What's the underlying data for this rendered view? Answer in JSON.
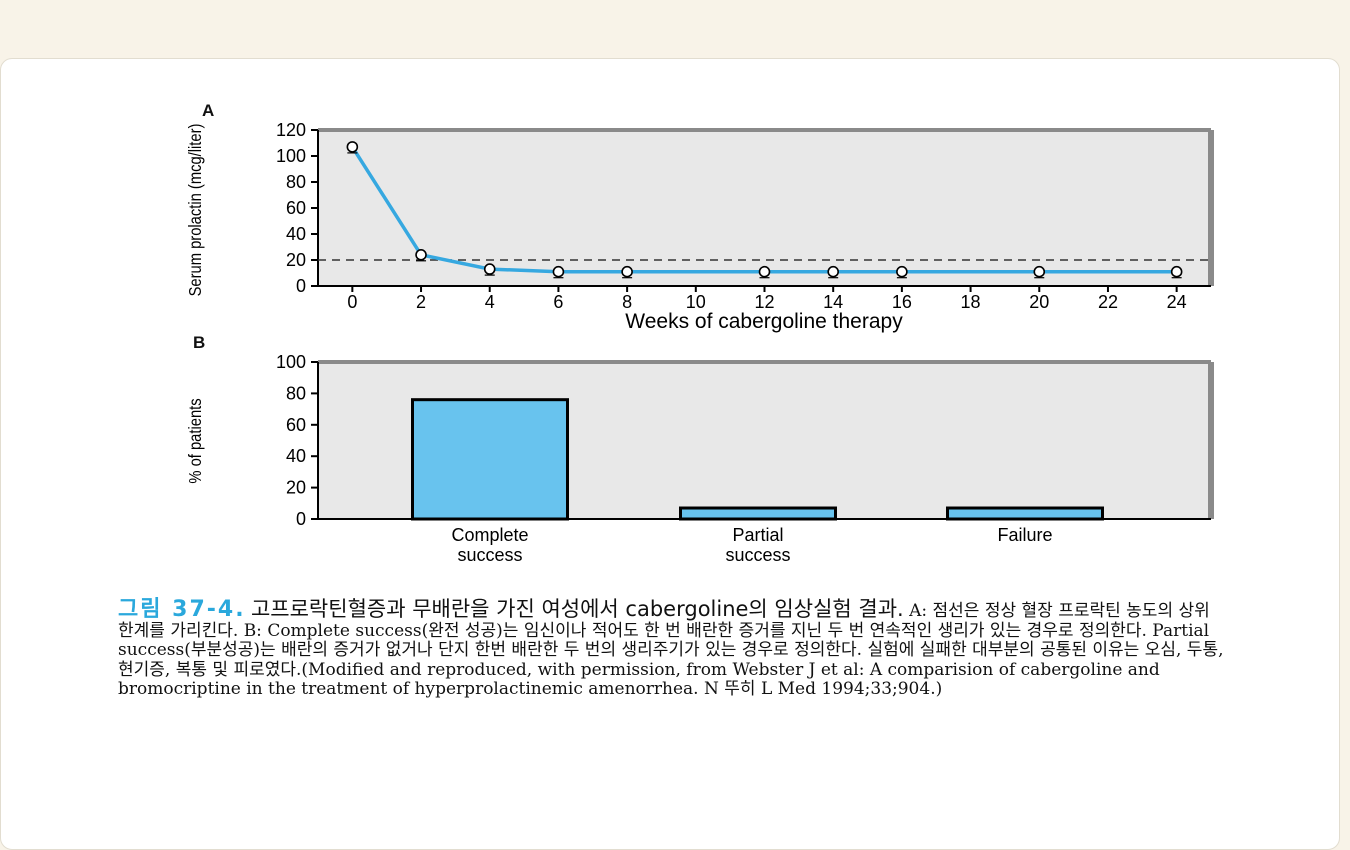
{
  "chart_data": [
    {
      "panel": "A",
      "type": "line",
      "xlabel": "Weeks of cabergoline therapy",
      "ylabel": "Serum prolactin (mcg/liter)",
      "ylim": [
        0,
        120
      ],
      "yticks": [
        0,
        20,
        40,
        60,
        80,
        100,
        120
      ],
      "xlim": [
        -1,
        25
      ],
      "xticks": [
        0,
        2,
        4,
        6,
        8,
        10,
        12,
        14,
        16,
        18,
        20,
        22,
        24
      ],
      "reference_line": 20,
      "series": [
        {
          "x": [
            0,
            2,
            4,
            6,
            8,
            12,
            14,
            16,
            20,
            24
          ],
          "y": [
            107,
            24,
            13,
            11,
            11,
            11,
            11,
            11,
            11,
            11
          ]
        }
      ],
      "grid": false
    },
    {
      "panel": "B",
      "type": "bar",
      "ylabel": "% of patients",
      "ylim": [
        0,
        100
      ],
      "yticks": [
        0,
        20,
        40,
        60,
        80,
        100
      ],
      "categories": [
        [
          "Complete",
          "success"
        ],
        [
          "Partial",
          "success"
        ],
        [
          "Failure"
        ]
      ],
      "values": [
        76,
        7,
        7
      ],
      "grid": false
    }
  ],
  "colors": {
    "line": "#36a8e0",
    "bar_fill": "#68c3ee",
    "plot_bg": "#e8e8e8",
    "frame": "#8a8a8a",
    "caption_accent": "#2aa8dc"
  },
  "caption": {
    "figure_number": "그림 37-4.",
    "title": "고프로락틴혈증과 무배란을 가진 여성에서 cabergoline의 임상실험 결과.",
    "body": " A: 점선은 정상 혈장 프로락틴 농도의 상위 한계를 가리킨다. B: Complete success(완전 성공)는 임신이나 적어도 한 번 배란한 증거를 지닌 두 번 연속적인 생리가 있는 경우로 정의한다. Partial success(부분성공)는 배란의 증거가 없거나 단지 한번 배란한 두 번의 생리주기가 있는 경우로 정의한다. 실험에 실패한 대부분의 공통된 이유는 오심, 두통, 현기증, 복통 및 피로였다.(Modified and reproduced, with permission, from Webster J et al: A comparision of cabergoline and bromocriptine in the treatment of hyperprolactinemic amenorrhea. N 뚜히 L Med 1994;33;904.)"
  }
}
